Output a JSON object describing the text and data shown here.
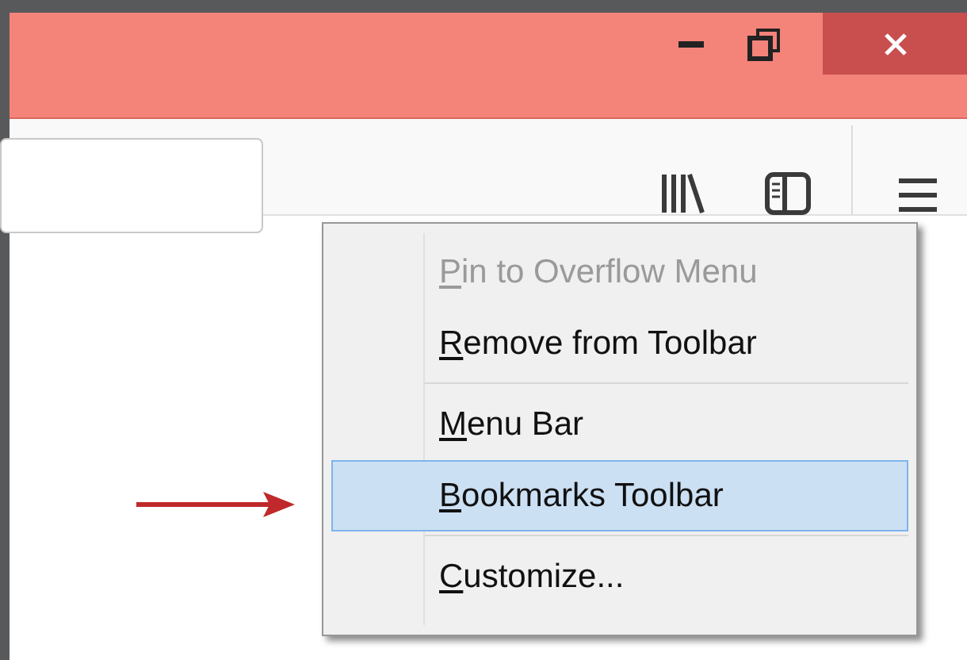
{
  "window_controls": [
    {
      "kind": "minimize"
    },
    {
      "kind": "restore"
    },
    {
      "kind": "close"
    }
  ],
  "context_menu": {
    "items": [
      {
        "kind": "item",
        "label": "Pin to Overflow Menu",
        "disabled": true,
        "selected": false,
        "mnemonic_first": true
      },
      {
        "kind": "item",
        "label": "Remove from Toolbar",
        "disabled": false,
        "selected": false,
        "mnemonic_first": true
      },
      {
        "kind": "separator"
      },
      {
        "kind": "item",
        "label": "Menu Bar",
        "disabled": false,
        "selected": false,
        "mnemonic_first": true
      },
      {
        "kind": "item",
        "label": "Bookmarks Toolbar",
        "disabled": false,
        "selected": true,
        "mnemonic_first": true
      },
      {
        "kind": "separator"
      },
      {
        "kind": "item",
        "label": "Customize...",
        "disabled": false,
        "selected": false,
        "mnemonic_first": true
      }
    ]
  }
}
